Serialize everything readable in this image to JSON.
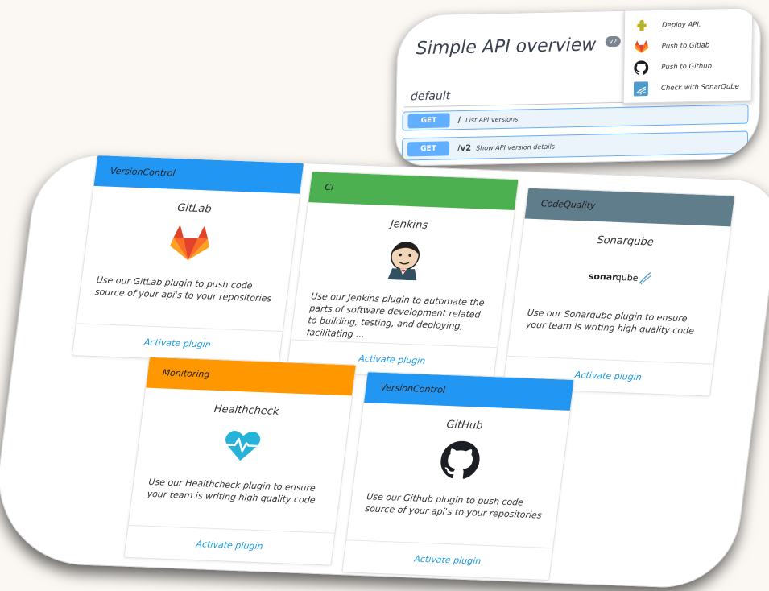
{
  "api": {
    "title": "Simple API overview",
    "version": "v2",
    "section": "default",
    "operations": [
      {
        "method": "GET",
        "path": "/",
        "description": "List API versions"
      },
      {
        "method": "GET",
        "path": "/v2",
        "description": "Show API version details"
      }
    ]
  },
  "menu": {
    "items": [
      {
        "label": "Deploy API.",
        "icon": "puzzle-icon"
      },
      {
        "label": "Push to Gitlab",
        "icon": "gitlab-icon"
      },
      {
        "label": "Push to Github",
        "icon": "github-icon"
      },
      {
        "label": "Check with SonarQube",
        "icon": "sonarqube-icon"
      }
    ]
  },
  "cards": [
    {
      "category": "VersionControl",
      "name": "GitLab",
      "logo": "gitlab-logo",
      "description": "Use our GitLab plugin to push code source of your api's to your repositories",
      "action": "Activate plugin",
      "color": "#2196f3"
    },
    {
      "category": "Ci",
      "name": "Jenkins",
      "logo": "jenkins-logo",
      "description": "Use our Jenkins plugin to automate the parts of software development related to building, testing, and deploying, facilitating ...",
      "action": "Activate plugin",
      "color": "#4caf50"
    },
    {
      "category": "CodeQuality",
      "name": "Sonarqube",
      "logo": "sonarqube-logo",
      "description": "Use our Sonarqube plugin to ensure your team is writing high quality code",
      "action": "Activate plugin",
      "color": "#607d8b"
    },
    {
      "category": "Monitoring",
      "name": "Healthcheck",
      "logo": "heart-pulse-logo",
      "description": "Use our Healthcheck plugin to ensure your team is writing high quality code",
      "action": "Activate plugin",
      "color": "#ff9800"
    },
    {
      "category": "VersionControl",
      "name": "GitHub",
      "logo": "github-logo",
      "description": "Use our Github plugin to push code source of your api's to your repositories",
      "action": "Activate plugin",
      "color": "#2196f3"
    }
  ],
  "sonar_wordmark": "sonarqube"
}
